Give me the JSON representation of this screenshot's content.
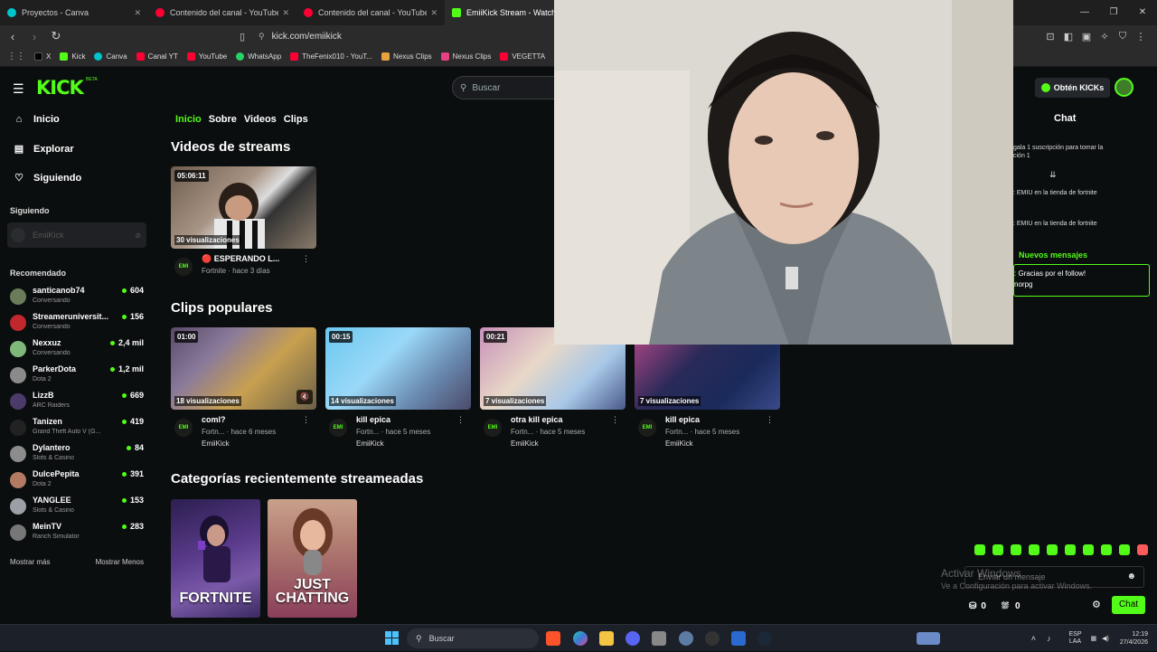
{
  "browser": {
    "tabs": [
      {
        "label": "Proyectos - Canva",
        "color": "#00c4cc"
      },
      {
        "label": "Contenido del canal - YouTube Studio",
        "color": "#ff0033"
      },
      {
        "label": "Contenido del canal - YouTube Studio",
        "color": "#ff0033"
      },
      {
        "label": "EmiiKick Stream - Watch Live",
        "color": "#53fc18"
      }
    ],
    "url": "kick.com/emiikick",
    "bookmarks": [
      "X",
      "Kick",
      "Canva",
      "Canal YT",
      "YouTube",
      "WhatsApp",
      "TheFenix010 - YouT...",
      "Nexus Clips",
      "Nexus Clips",
      "VEGETTA"
    ]
  },
  "header": {
    "logo": "KICK",
    "logo_sup": "BETA",
    "search_placeholder": "Buscar",
    "get_kicks": "Obtén KICKs"
  },
  "sidebar": {
    "nav": [
      "Inicio",
      "Explorar",
      "Siguiendo"
    ],
    "following_title": "Siguiendo",
    "following_channel": "EmiiKick",
    "recommended_title": "Recomendado",
    "recommended": [
      {
        "name": "santicanob74",
        "game": "Conversando",
        "viewers": "604",
        "color": "#6a7c5a"
      },
      {
        "name": "Streameruniversit...",
        "game": "Conversando",
        "viewers": "156",
        "color": "#c0282d"
      },
      {
        "name": "Nexxuz",
        "game": "Conversando",
        "viewers": "2,4 mil",
        "color": "#7fb87a"
      },
      {
        "name": "ParkerDota",
        "game": "Dota 2",
        "viewers": "1,2 mil",
        "color": "#8a8a8a"
      },
      {
        "name": "LizzB",
        "game": "ARC Raiders",
        "viewers": "669",
        "color": "#4b3b6b"
      },
      {
        "name": "Tanizen",
        "game": "Grand Theft Auto V (G...",
        "viewers": "419",
        "color": "#222222"
      },
      {
        "name": "Dylantero",
        "game": "Slots & Casino",
        "viewers": "84",
        "color": "#8c8c8c"
      },
      {
        "name": "DulcePepita",
        "game": "Dota 2",
        "viewers": "391",
        "color": "#b27a63"
      },
      {
        "name": "YANGLEE",
        "game": "Slots & Casino",
        "viewers": "153",
        "color": "#9aa0a6"
      },
      {
        "name": "MeinTV",
        "game": "Ranch Simulator",
        "viewers": "283",
        "color": "#777777"
      }
    ],
    "show_more": "Mostrar más",
    "show_less": "Mostrar Menos"
  },
  "main": {
    "tabs": [
      "Inicio",
      "Sobre",
      "Videos",
      "Clips"
    ],
    "videos_title": "Videos de streams",
    "video": {
      "duration": "05:06:11",
      "views": "30 visualizaciones",
      "title": "🔴 ESPERANDO L...",
      "meta": "Fortnite · hace 3 días"
    },
    "clips_title": "Clips populares",
    "clips": [
      {
        "duration": "01:00",
        "views": "18 visualizaciones",
        "title": "coml?",
        "meta": "Fortn... · hace 6 meses",
        "author": "EmiiKick"
      },
      {
        "duration": "00:15",
        "views": "14 visualizaciones",
        "title": "kill epica",
        "meta": "Fortn... · hace 5 meses",
        "author": "EmiiKick"
      },
      {
        "duration": "00:21",
        "views": "7 visualizaciones",
        "title": "otra kill epica",
        "meta": "Fortn... · hace 5 meses",
        "author": "EmiiKick"
      },
      {
        "duration": "",
        "views": "7 visualizaciones",
        "title": "kill epica",
        "meta": "Fortn... · hace 5 meses",
        "author": "EmiiKick"
      }
    ],
    "categories_title": "Categorías recientemente streameadas",
    "categories": [
      "FORTNITE",
      "JUST CHATTING"
    ]
  },
  "chat": {
    "title": "Chat",
    "messages": [
      "gala 1 suscripción para tomar la",
      "ción 1",
      ": EMIU en la tienda de fortnite",
      ": EMIU en la tienda de fortnite"
    ],
    "new_messages_label": "Nuevos mensajes",
    "new_message_line1": ": Gracias por el follow!",
    "new_message_line2": "norpg",
    "input_placeholder": "Enviar un mensaje",
    "kicks_count": "0",
    "gifts_count": "0",
    "chat_button": "Chat"
  },
  "watermark": {
    "line1": "Activar Windows",
    "line2": "Ve a Configuración para activar Windows."
  },
  "taskbar": {
    "search_label": "Buscar",
    "lang": "ESP",
    "lang2": "LAA",
    "time": "12:19",
    "date": "27/4/2026"
  }
}
